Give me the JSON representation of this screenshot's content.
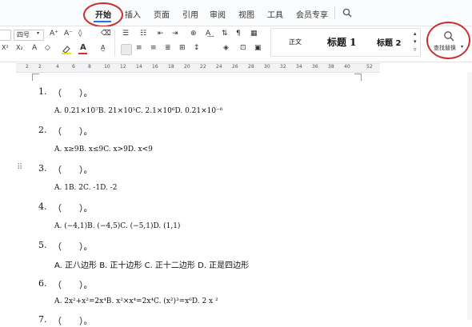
{
  "tabs": [
    "开始",
    "插入",
    "页面",
    "引用",
    "审阅",
    "视图",
    "工具",
    "会员专享"
  ],
  "ribbon": {
    "font_size": "四号",
    "styles": [
      "正文",
      "标题 1",
      "标题 2"
    ],
    "find_replace": "查找替换"
  },
  "ruler": [
    "2",
    "2",
    "4",
    "6",
    "8",
    "10",
    "12",
    "14",
    "16",
    "18",
    "20",
    "22",
    "24",
    "26",
    "28",
    "30",
    "32",
    "34",
    "36",
    "38",
    "40",
    "52"
  ],
  "questions": [
    {
      "n": "1.",
      "bracket": "（　　）。",
      "opts": "A.  0.21×10⁷B.   21×10⁵C.   2.1×10⁶D.   0.21×10⁻⁶"
    },
    {
      "n": "2.",
      "bracket": "（　　）。",
      "opts": "A.  x≥9B.   x≤9C.   x>9D.   x<9"
    },
    {
      "n": "3.",
      "bracket": "（　　）。",
      "opts": "A.  1B.  2C.  -1D.  -2"
    },
    {
      "n": "4.",
      "bracket": "（　　）。",
      "opts": "A.  (−4,1)B.   (−4,5)C.   (−5,1)D.   (1,1)"
    },
    {
      "n": "5.",
      "bracket": "（　　）。",
      "opts": "A.  正八边形 B.  正十边形 C.  正十二边形 D.  正是四边形"
    },
    {
      "n": "6.",
      "bracket": "（　　）。",
      "opts": "A.  2x²+x²=2x⁴B.   x²×x⁴=2x⁴C.   (x²)³=x⁶D.    2    x    ²"
    },
    {
      "n": "7.",
      "bracket": "（　　）。",
      "opts": ""
    }
  ]
}
